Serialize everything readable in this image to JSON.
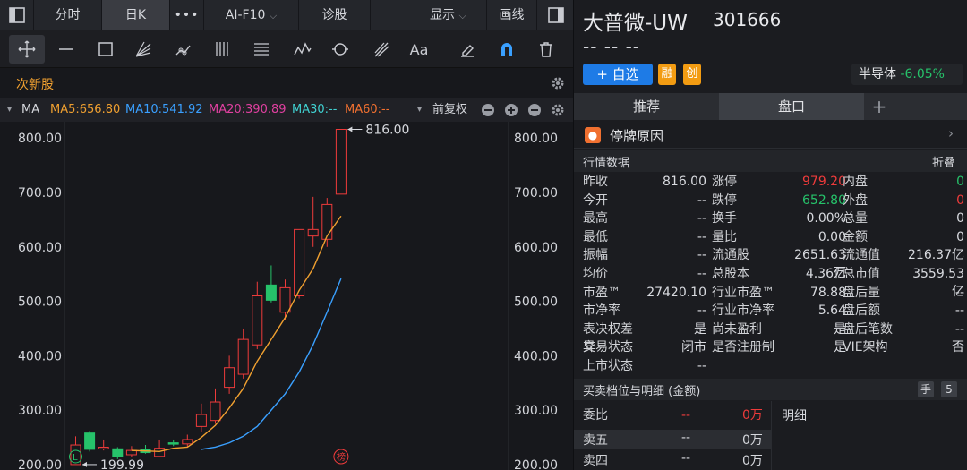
{
  "topbar": {
    "back_icon": "panel-left-icon",
    "tabs": [
      "分时",
      "日K"
    ],
    "more": "•••",
    "aif10": "AI-F10",
    "zhengu": "诊股",
    "display": "显示",
    "draw": "画线",
    "right_icon": "panel-right-icon"
  },
  "tools": [
    "crosshair-icon",
    "line-icon",
    "rect-icon",
    "fan-icon",
    "segment-icon",
    "vlines-icon",
    "fib-icon",
    "wave-icon",
    "cycle-icon",
    "gann-icon",
    "text-icon",
    "eraser-icon",
    "magnet-icon",
    "trash-icon"
  ],
  "tools_text": {
    "text": "Aa"
  },
  "sub": {
    "label": "次新股"
  },
  "ma": {
    "name": "MA",
    "ma5": "MA5:656.80",
    "ma10": "MA10:541.92",
    "ma20": "MA20:390.89",
    "ma30": "MA30:--",
    "ma60": "MA60:--",
    "adjust": "前复权"
  },
  "colors": {
    "ma5": "#f0a030",
    "ma10": "#3aa0ff",
    "ma20": "#e040a0",
    "ma30": "#40d0d0",
    "ma60": "#f07030",
    "up": "#ee3b3b",
    "down": "#26c26a"
  },
  "chart_data": {
    "type": "candlestick",
    "ylim": [
      190,
      830
    ],
    "yticks": [
      "800.00",
      "700.00",
      "600.00",
      "500.00",
      "400.00",
      "300.00",
      "200.00"
    ],
    "high_label": "816.00",
    "low_label": "199.99",
    "candles": [
      {
        "o": 200,
        "c": 236,
        "h": 252,
        "l": 199.99
      },
      {
        "o": 258,
        "c": 228,
        "h": 262,
        "l": 224
      },
      {
        "o": 229,
        "c": 232,
        "h": 246,
        "l": 226
      },
      {
        "o": 229,
        "c": 214,
        "h": 232,
        "l": 210
      },
      {
        "o": 218,
        "c": 226,
        "h": 234,
        "l": 214
      },
      {
        "o": 228,
        "c": 222,
        "h": 236,
        "l": 220
      },
      {
        "o": 215,
        "c": 230,
        "h": 246,
        "l": 213
      },
      {
        "o": 240,
        "c": 238,
        "h": 246,
        "l": 234
      },
      {
        "o": 238,
        "c": 246,
        "h": 255,
        "l": 232
      },
      {
        "o": 270,
        "c": 292,
        "h": 312,
        "l": 260
      },
      {
        "o": 281,
        "c": 315,
        "h": 340,
        "l": 275
      },
      {
        "o": 342,
        "c": 378,
        "h": 400,
        "l": 330
      },
      {
        "o": 366,
        "c": 430,
        "h": 450,
        "l": 358
      },
      {
        "o": 420,
        "c": 510,
        "h": 536,
        "l": 412
      },
      {
        "o": 530,
        "c": 502,
        "h": 566,
        "l": 498
      },
      {
        "o": 480,
        "c": 525,
        "h": 540,
        "l": 466
      },
      {
        "o": 510,
        "c": 632,
        "h": 632,
        "l": 505
      },
      {
        "o": 620,
        "c": 632,
        "h": 692,
        "l": 600
      },
      {
        "o": 614,
        "c": 678,
        "h": 690,
        "l": 600
      },
      {
        "o": 697,
        "c": 816,
        "h": 816,
        "l": 697
      }
    ],
    "ma5": [
      null,
      null,
      null,
      null,
      226,
      225,
      224,
      230,
      232,
      250,
      272,
      304,
      340,
      390,
      430,
      470,
      520,
      560,
      620,
      656.8
    ],
    "ma10": [
      null,
      null,
      null,
      null,
      null,
      null,
      null,
      null,
      null,
      228,
      232,
      240,
      252,
      270,
      300,
      330,
      370,
      420,
      480,
      541.92
    ]
  },
  "markers": {
    "L": "L",
    "bang": "榜"
  },
  "right": {
    "title": "大普微-UW",
    "code": "301666",
    "dashes": "-- -- --",
    "add_btn": "+ 自选",
    "rong": "融",
    "chuang": "创",
    "sector": "半导体",
    "sector_chg": "-6.05%",
    "tabs": [
      "推荐",
      "盘口",
      "+"
    ],
    "halt": "停牌原因",
    "market_title": "行情数据",
    "fold": "折叠",
    "rows": [
      [
        "昨收",
        "816.00",
        "涨停",
        "979.20",
        "内盘",
        "0"
      ],
      [
        "今开",
        "--",
        "跌停",
        "652.80",
        "外盘",
        "0"
      ],
      [
        "最高",
        "--",
        "换手",
        "0.00%",
        "总量",
        "0"
      ],
      [
        "最低",
        "--",
        "量比",
        "0.00",
        "金额",
        "0"
      ],
      [
        "振幅",
        "--",
        "流通股",
        "2651.63万",
        "流通值",
        "216.37亿"
      ],
      [
        "均价",
        "--",
        "总股本",
        "4.36亿",
        "总市值",
        "3559.53亿"
      ],
      [
        "市盈™",
        "27420.10",
        "行业市盈™",
        "78.88",
        "盘后量",
        "--"
      ],
      [
        "市净率",
        "--",
        "行业市净率",
        "5.64",
        "盘后额",
        "--"
      ],
      [
        "表决权差异",
        "是",
        "尚未盈利",
        "是",
        "盘后笔数",
        "--"
      ],
      [
        "交易状态",
        "闭市",
        "是否注册制",
        "是",
        "VIE架构",
        "否"
      ],
      [
        "上市状态",
        "--",
        "",
        "",
        "",
        ""
      ]
    ],
    "bid_title": "买卖档位与明细 (金额)",
    "hand": "手",
    "five": "5",
    "weibi": "委比",
    "weibi_v1": "--",
    "weibi_v2": "0万",
    "mingxi": "明细",
    "sell5": "卖五",
    "sell5_v1": "--",
    "sell5_v2": "0万",
    "sell4": "卖四",
    "sell4_v1": "--",
    "sell4_v2": "0万"
  }
}
